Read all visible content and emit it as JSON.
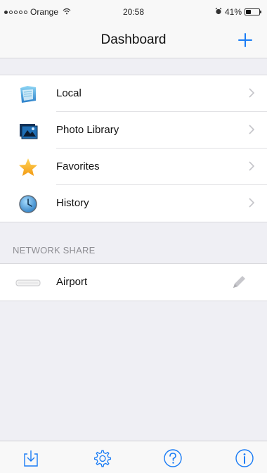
{
  "status_bar": {
    "carrier": "Orange",
    "time": "20:58",
    "battery_percent": "41%",
    "battery_level": 0.41,
    "signal_bars_filled": 1,
    "signal_bars_total": 5
  },
  "nav": {
    "title": "Dashboard",
    "add_icon": "plus-icon"
  },
  "main_list": {
    "items": [
      {
        "label": "Local",
        "icon": "local-folder-icon"
      },
      {
        "label": "Photo Library",
        "icon": "photo-library-icon"
      },
      {
        "label": "Favorites",
        "icon": "star-icon"
      },
      {
        "label": "History",
        "icon": "clock-icon"
      }
    ]
  },
  "network_share": {
    "header": "NETWORK SHARE",
    "items": [
      {
        "label": "Airport",
        "icon": "drive-icon",
        "action_icon": "pencil-icon"
      }
    ]
  },
  "tab_bar": {
    "tabs": [
      {
        "icon": "download-icon"
      },
      {
        "icon": "gear-icon"
      },
      {
        "icon": "help-icon"
      },
      {
        "icon": "info-icon"
      }
    ]
  },
  "colors": {
    "accent": "#1a7cf5",
    "background": "#efeff4",
    "separator": "#e1e1e4",
    "section_header": "#8e8e93"
  }
}
